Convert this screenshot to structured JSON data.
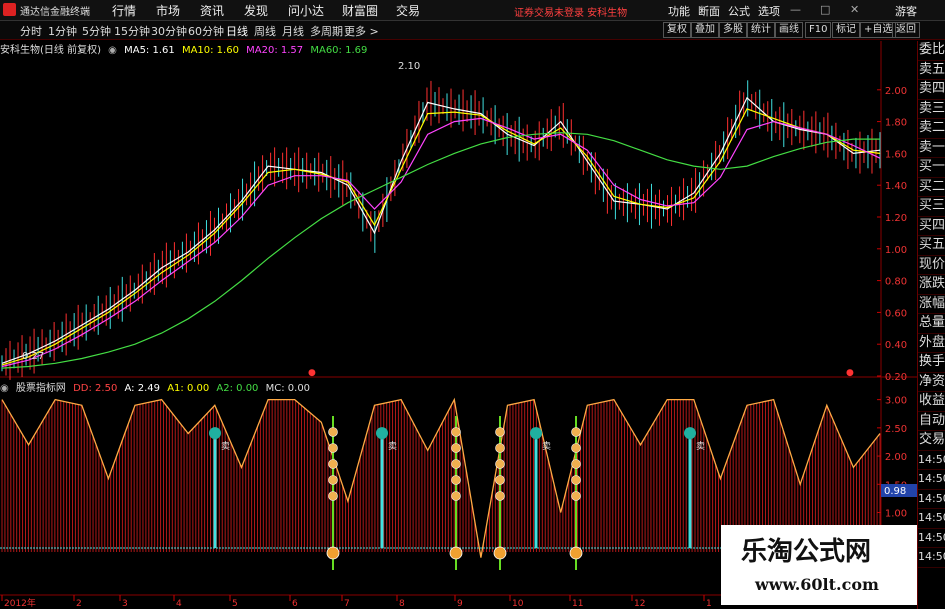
{
  "menubar": {
    "app_title": "通达信金融终端",
    "menus": [
      "行情",
      "市场",
      "资讯",
      "发现",
      "问小达",
      "财富圈",
      "交易"
    ],
    "notice": "证券交易未登录  安科生物",
    "right_items": [
      "功能",
      "断面",
      "公式",
      "选项",
      "游客"
    ]
  },
  "toolbar": {
    "periods": [
      "分时",
      "1分钟",
      "5分钟",
      "15分钟",
      "30分钟",
      "60分钟",
      "日线",
      "周线",
      "月线",
      "多周期",
      "更多 >"
    ],
    "active_period": "日线",
    "right_buttons": [
      "复权",
      "叠加",
      "多股",
      "统计",
      "画线",
      "F10",
      "标记",
      "+自选",
      "返回"
    ]
  },
  "chart_info": {
    "stock": "安科生物(日线 前复权)",
    "ma5": "MA5: 1.61",
    "ma10": "MA10: 1.60",
    "ma20": "MA20: 1.57",
    "ma60": "MA60: 1.69",
    "high_label": "2.10",
    "low_label": "0.27"
  },
  "indicator_info": {
    "name": "股票指标网",
    "dd": "DD: 2.50",
    "a": "A: 2.49",
    "a1": "A1: 0.00",
    "a2": "A2: 0.00",
    "mc": "MC: 0.00",
    "current_value": "0.98"
  },
  "right_panel": [
    "委比",
    "卖五",
    "卖四",
    "卖三",
    "卖二",
    "卖一",
    "买一",
    "买二",
    "买三",
    "买四",
    "买五",
    "现价",
    "涨跌",
    "涨幅",
    "总量",
    "外盘",
    "换手",
    "净资",
    "收益",
    "自动",
    "交易",
    "14:50",
    "14:50",
    "14:50",
    "14:50",
    "14:50",
    "14:50"
  ],
  "chart_data": [
    {
      "type": "line",
      "title": "安科生物(日线 前复权)",
      "y_ticks": [
        "2.00",
        "1.80",
        "1.60",
        "1.40",
        "1.20",
        "1.00",
        "0.80",
        "0.60",
        "0.40",
        "0.20"
      ],
      "ylim": [
        0.2,
        2.2
      ],
      "x_ticks": [
        "2012年",
        "2",
        "3",
        "4",
        "5",
        "6",
        "7",
        "8",
        "9",
        "10",
        "11",
        "12",
        "1"
      ],
      "series": [
        {
          "name": "MA5",
          "color": "#ffffff",
          "values": [
            0.28,
            0.34,
            0.42,
            0.52,
            0.62,
            0.74,
            0.88,
            0.98,
            1.12,
            1.3,
            1.52,
            1.5,
            1.48,
            1.4,
            1.1,
            1.55,
            1.92,
            1.88,
            1.85,
            1.72,
            1.65,
            1.8,
            1.55,
            1.3,
            1.28,
            1.25,
            1.35,
            1.6,
            1.95,
            1.8,
            1.75,
            1.72,
            1.6,
            1.62
          ]
        },
        {
          "name": "MA10",
          "color": "#ffff00",
          "values": [
            0.27,
            0.32,
            0.4,
            0.5,
            0.6,
            0.72,
            0.85,
            0.96,
            1.1,
            1.28,
            1.48,
            1.5,
            1.47,
            1.42,
            1.15,
            1.5,
            1.85,
            1.86,
            1.84,
            1.74,
            1.66,
            1.76,
            1.58,
            1.33,
            1.28,
            1.26,
            1.32,
            1.55,
            1.88,
            1.82,
            1.76,
            1.72,
            1.62,
            1.6
          ]
        },
        {
          "name": "MA20",
          "color": "#ff44ff",
          "values": [
            0.26,
            0.3,
            0.37,
            0.46,
            0.56,
            0.67,
            0.8,
            0.92,
            1.04,
            1.2,
            1.4,
            1.46,
            1.46,
            1.43,
            1.25,
            1.42,
            1.72,
            1.8,
            1.82,
            1.76,
            1.69,
            1.72,
            1.62,
            1.4,
            1.31,
            1.27,
            1.29,
            1.45,
            1.75,
            1.8,
            1.76,
            1.72,
            1.65,
            1.57
          ]
        },
        {
          "name": "MA60",
          "color": "#44dd44",
          "values": [
            0.25,
            0.26,
            0.28,
            0.31,
            0.35,
            0.4,
            0.47,
            0.56,
            0.67,
            0.8,
            0.94,
            1.07,
            1.19,
            1.29,
            1.37,
            1.45,
            1.53,
            1.6,
            1.66,
            1.7,
            1.72,
            1.73,
            1.72,
            1.68,
            1.62,
            1.56,
            1.52,
            1.5,
            1.52,
            1.58,
            1.63,
            1.67,
            1.69,
            1.69
          ]
        }
      ]
    },
    {
      "type": "area",
      "title": "股票指标网",
      "y_ticks": [
        "3.00",
        "2.50",
        "2.00",
        "1.50",
        "1.00",
        "0.50"
      ],
      "ylim": [
        0.3,
        3.1
      ],
      "series": [
        {
          "name": "DD",
          "color": "#ffaa44",
          "values": [
            3.0,
            2.2,
            3.0,
            2.9,
            1.6,
            2.9,
            3.0,
            2.4,
            2.9,
            1.8,
            3.0,
            3.0,
            2.6,
            1.2,
            2.9,
            3.0,
            2.1,
            3.0,
            0.2,
            2.9,
            3.0,
            1.0,
            2.9,
            3.0,
            2.2,
            3.0,
            3.0,
            1.6,
            2.9,
            3.0,
            1.5,
            2.9,
            1.8,
            2.4
          ]
        }
      ],
      "signals": {
        "sell_labels": [
          "卖",
          "卖",
          "卖",
          "卖",
          "卖",
          "卖"
        ],
        "sell_values": [
          2.3,
          2.3,
          2.3,
          2.3,
          2.3,
          2.3
        ]
      }
    }
  ]
}
